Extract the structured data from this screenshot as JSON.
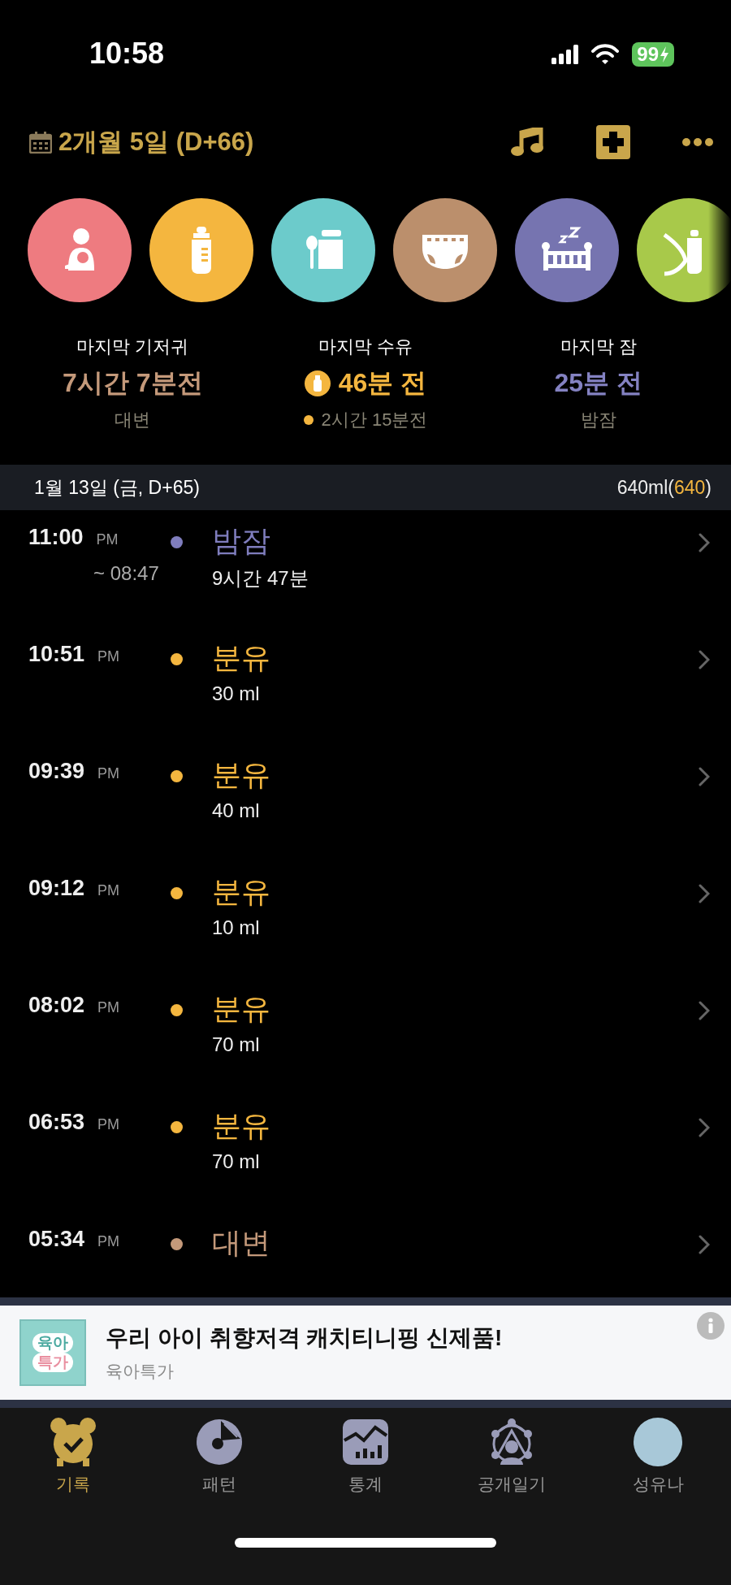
{
  "status_bar": {
    "time": "10:58",
    "battery": "99"
  },
  "header": {
    "date": "2개월 5일 (D+66)"
  },
  "categories": [
    {
      "kind": "nursing",
      "color": "#ee7b80"
    },
    {
      "kind": "bottle",
      "color": "#f4b63f"
    },
    {
      "kind": "baby-food",
      "color": "#6ccbcb"
    },
    {
      "kind": "diaper",
      "color": "#bb8f6c"
    },
    {
      "kind": "sleep",
      "color": "#7674b0"
    },
    {
      "kind": "pump",
      "color": "#a8c94a"
    }
  ],
  "summary": [
    {
      "kind": "plain",
      "label": "마지막 기저귀",
      "value": "7시간 7분전",
      "sub": "대변",
      "color": "#c4997a"
    },
    {
      "kind": "feeding",
      "label": "마지막 수유",
      "value": "46분 전",
      "sub": "2시간 15분전",
      "color": "#f4b63f"
    },
    {
      "kind": "plain",
      "label": "마지막 잠",
      "value": "25분 전",
      "sub": "밤잠",
      "color": "#8482c2"
    }
  ],
  "day": {
    "date": "1월 13일 (금, D+65)",
    "total_prefix": "640ml(",
    "total_highlight": "640",
    "total_suffix": ")"
  },
  "entries": [
    {
      "time": "11:00",
      "ampm": "PM",
      "until": "~ 08:47",
      "title": "밤잠",
      "detail": "9시간 47분",
      "color": "#7f7dbd"
    },
    {
      "time": "10:51",
      "ampm": "PM",
      "title": "분유",
      "detail": "30 ml",
      "color": "#f4b63f"
    },
    {
      "time": "09:39",
      "ampm": "PM",
      "title": "분유",
      "detail": "40 ml",
      "color": "#f4b63f"
    },
    {
      "time": "09:12",
      "ampm": "PM",
      "title": "분유",
      "detail": "10 ml",
      "color": "#f4b63f"
    },
    {
      "time": "08:02",
      "ampm": "PM",
      "title": "분유",
      "detail": "70 ml",
      "color": "#f4b63f"
    },
    {
      "time": "06:53",
      "ampm": "PM",
      "title": "분유",
      "detail": "70 ml",
      "color": "#f4b63f"
    },
    {
      "time": "05:34",
      "ampm": "PM",
      "title": "대변",
      "color": "#c4997a"
    }
  ],
  "ad": {
    "logo_lines": [
      "육아",
      "특가"
    ],
    "title": "우리 아이 취향저격 캐치티니핑 신제품!",
    "source": "육아특가"
  },
  "tabs": [
    {
      "kind": "record",
      "label": "기록",
      "selected": true
    },
    {
      "kind": "pattern",
      "label": "패턴",
      "selected": false
    },
    {
      "kind": "stats",
      "label": "통계",
      "selected": false
    },
    {
      "kind": "diary",
      "label": "공개일기",
      "selected": false
    },
    {
      "kind": "profile",
      "label": "성유나",
      "selected": false
    }
  ]
}
